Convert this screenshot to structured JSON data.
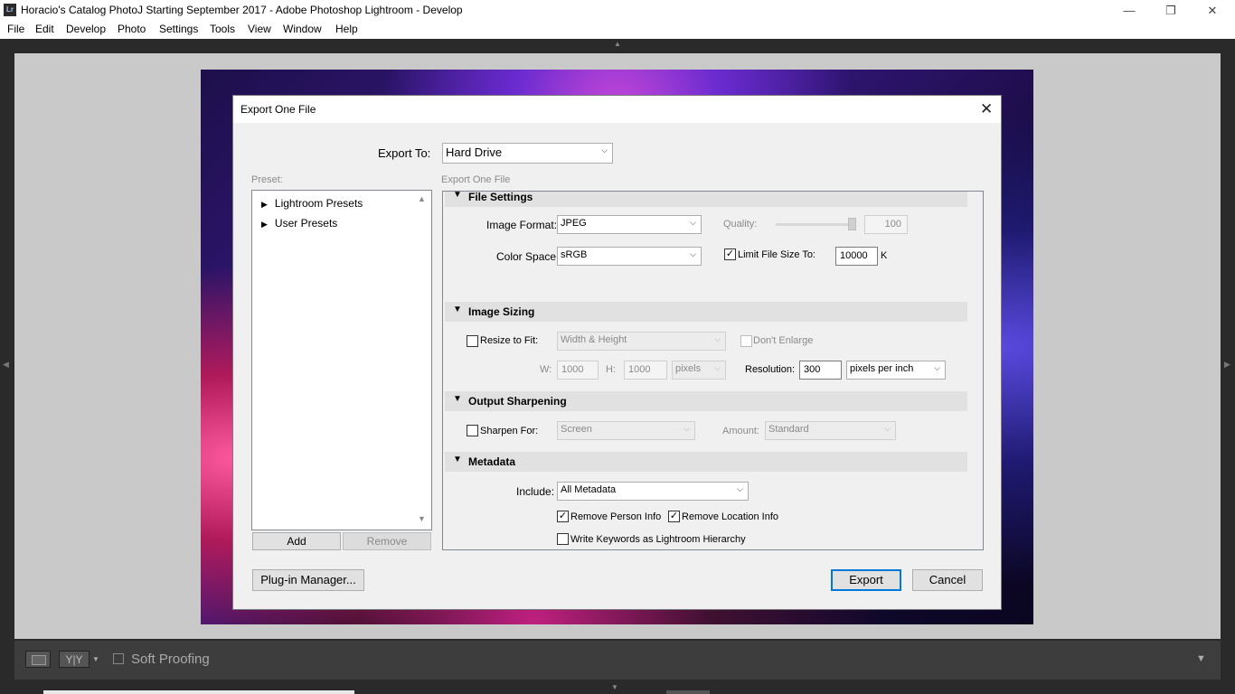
{
  "window": {
    "title": "Horacio's Catalog PhotoJ Starting September 2017 - Adobe Photoshop Lightroom - Develop",
    "icon": "Lr",
    "minimize": "—",
    "restore": "❐",
    "close": "✕"
  },
  "menu": [
    "File",
    "Edit",
    "Develop",
    "Photo",
    "Settings",
    "Tools",
    "View",
    "Window",
    "Help"
  ],
  "toolbar": {
    "soft_proofing": "Soft Proofing",
    "yy": "Y|Y"
  },
  "dialog": {
    "title": "Export One File",
    "export_to_label": "Export To:",
    "export_to_value": "Hard Drive",
    "preset_label": "Preset:",
    "settings_label": "Export One File",
    "presets": [
      "Lightroom Presets",
      "User Presets"
    ],
    "add": "Add",
    "remove": "Remove",
    "plugin_manager": "Plug-in Manager...",
    "export": "Export",
    "cancel": "Cancel",
    "file_settings": {
      "header": "File Settings",
      "image_format_label": "Image Format:",
      "image_format": "JPEG",
      "quality_label": "Quality:",
      "quality": "100",
      "quality_level": 1.0,
      "color_space_label": "Color Space:",
      "color_space": "sRGB",
      "limit_label": "Limit File Size To:",
      "limit_checked": true,
      "limit_value": "10000",
      "limit_unit": "K"
    },
    "image_sizing": {
      "header": "Image Sizing",
      "resize_label": "Resize to Fit:",
      "resize_checked": false,
      "resize_mode": "Width & Height",
      "dont_enlarge": "Don't Enlarge",
      "w_label": "W:",
      "w": "1000",
      "h_label": "H:",
      "h": "1000",
      "units": "pixels",
      "resolution_label": "Resolution:",
      "resolution": "300",
      "resolution_units": "pixels per inch"
    },
    "output_sharpening": {
      "header": "Output Sharpening",
      "sharpen_label": "Sharpen For:",
      "sharpen_checked": false,
      "sharpen_for": "Screen",
      "amount_label": "Amount:",
      "amount": "Standard"
    },
    "metadata": {
      "header": "Metadata",
      "include_label": "Include:",
      "include": "All Metadata",
      "remove_person": "Remove Person Info",
      "remove_person_checked": true,
      "remove_location": "Remove Location Info",
      "remove_location_checked": true,
      "write_keywords": "Write Keywords as Lightroom Hierarchy",
      "write_keywords_checked": false
    }
  }
}
